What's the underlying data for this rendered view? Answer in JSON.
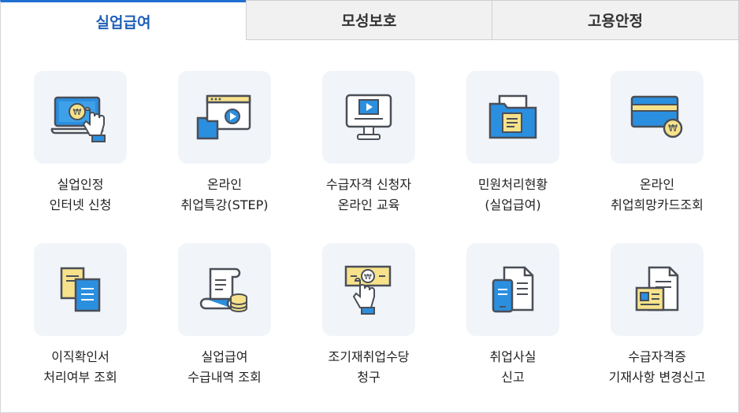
{
  "tabs": [
    {
      "label": "실업급여",
      "active": true
    },
    {
      "label": "모성보호",
      "active": false
    },
    {
      "label": "고용안정",
      "active": false
    }
  ],
  "items": [
    {
      "line1": "실업인정",
      "line2": "인터넷 신청",
      "icon": "laptop-won-hand-icon"
    },
    {
      "line1": "온라인",
      "line2": "취업특강(STEP)",
      "icon": "video-folder-icon"
    },
    {
      "line1": "수급자격 신청자",
      "line2": "온라인 교육",
      "icon": "monitor-play-icon"
    },
    {
      "line1": "민원처리현황",
      "line2": "(실업급여)",
      "icon": "folder-document-icon"
    },
    {
      "line1": "온라인",
      "line2": "취업희망카드조회",
      "icon": "card-won-icon"
    },
    {
      "line1": "이직확인서",
      "line2": "처리여부 조회",
      "icon": "documents-icon"
    },
    {
      "line1": "실업급여",
      "line2": "수급내역 조회",
      "icon": "scroll-coins-icon"
    },
    {
      "line1": "조기재취업수당",
      "line2": "청구",
      "icon": "bill-hand-icon"
    },
    {
      "line1": "취업사실",
      "line2": "신고",
      "icon": "phone-document-icon"
    },
    {
      "line1": "수급자격증",
      "line2": "기재사항 변경신고",
      "icon": "document-id-icon"
    }
  ],
  "colors": {
    "blue": "#2b8fe0",
    "dark": "#4a4f57",
    "yellow": "#f7e28b",
    "tab_active": "#1f5fb8"
  }
}
